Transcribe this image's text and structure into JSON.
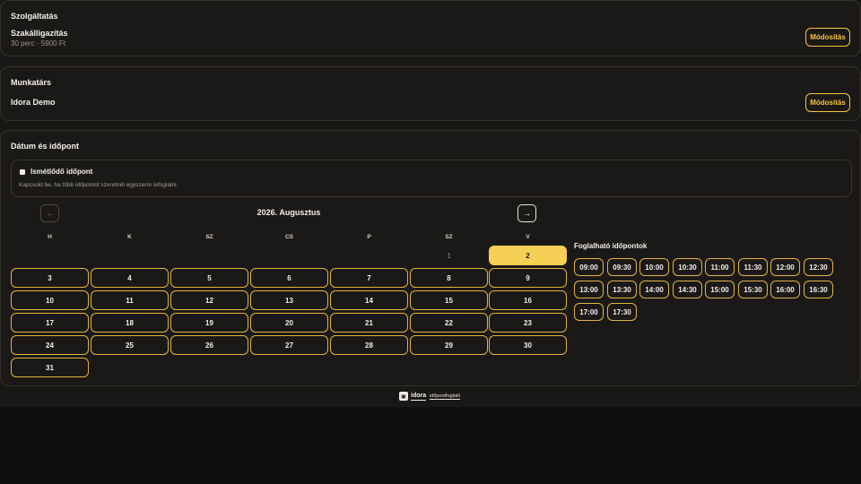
{
  "service": {
    "heading": "Szolgáltatás",
    "name": "Szakálligazítás",
    "details": "30 perc · 5900 Ft",
    "modify_label": "Módosítás"
  },
  "staff": {
    "heading": "Munkatárs",
    "name": "Idora Demo",
    "modify_label": "Módosítás"
  },
  "datetime": {
    "heading": "Dátum és időpont",
    "repeat": {
      "label": "Ismétlődő időpont",
      "help": "Kapcsold be, ha több időpontot szeretnél egyszerre lefoglalni.",
      "checked": false
    },
    "calendar": {
      "prev_icon": "←",
      "next_icon": "→",
      "month_label": "2026. Augusztus",
      "weekdays": [
        "H",
        "K",
        "SZ",
        "CS",
        "P",
        "SZ",
        "V"
      ],
      "first_weekday_index": 5,
      "days_in_month": 31,
      "past_days": [
        1
      ],
      "selected_day": 2
    },
    "slots": {
      "heading": "Foglalható időpontok",
      "times": [
        "09:00",
        "09:30",
        "10:00",
        "10:30",
        "11:00",
        "11:30",
        "12:00",
        "12:30",
        "13:00",
        "13:30",
        "14:00",
        "14:30",
        "15:00",
        "15:30",
        "16:00",
        "16:30",
        "17:00",
        "17:30"
      ]
    }
  },
  "footer": {
    "logo_icon": "calendar-logo-icon",
    "brand": "idora",
    "tagline": "időpontfoglaló"
  },
  "colors": {
    "accent": "#f6cf55",
    "border_accent": "#e0b53e",
    "background": "#1b1917"
  }
}
